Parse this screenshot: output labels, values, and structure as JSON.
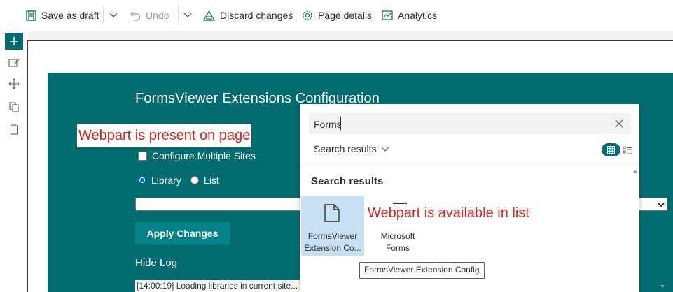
{
  "toolbar": {
    "save_label": "Save as draft",
    "undo_label": "Undo",
    "discard_label": "Discard changes",
    "page_details_label": "Page details",
    "analytics_label": "Analytics"
  },
  "webpart": {
    "title": "FormsViewer Extensions Configuration",
    "configure_multiple_sites": "Configure Multiple Sites",
    "radio_library": "Library",
    "radio_list": "List",
    "selected_radio": "Library",
    "apply_button": "Apply Changes",
    "hide_log": "Hide Log",
    "log_text": "[14:00:19] Loading libraries in current site..."
  },
  "annotations": {
    "present": "Webpart is present on page",
    "available": "Webpart is available in list"
  },
  "toolbox": {
    "search_value": "Forms",
    "dropdown_label": "Search results",
    "heading": "Search results",
    "tiles": [
      {
        "label_line1": "FormsViewer",
        "label_line2": "Extension Co...",
        "selected": true
      },
      {
        "label_line1": "Microsoft",
        "label_line2": "Forms",
        "selected": false
      }
    ],
    "tooltip": "FormsViewer Extension Config"
  },
  "colors": {
    "accent": "#036c70",
    "annotation": "#e0231f",
    "tile_selected": "#c7e0f4"
  },
  "icons": [
    "save-icon",
    "chevron-down-icon",
    "undo-icon",
    "discard-icon",
    "gear-icon",
    "analytics-icon",
    "add-icon",
    "edit-icon",
    "move-icon",
    "duplicate-icon",
    "delete-icon",
    "close-icon",
    "grid-view-icon",
    "list-view-icon",
    "document-icon"
  ]
}
